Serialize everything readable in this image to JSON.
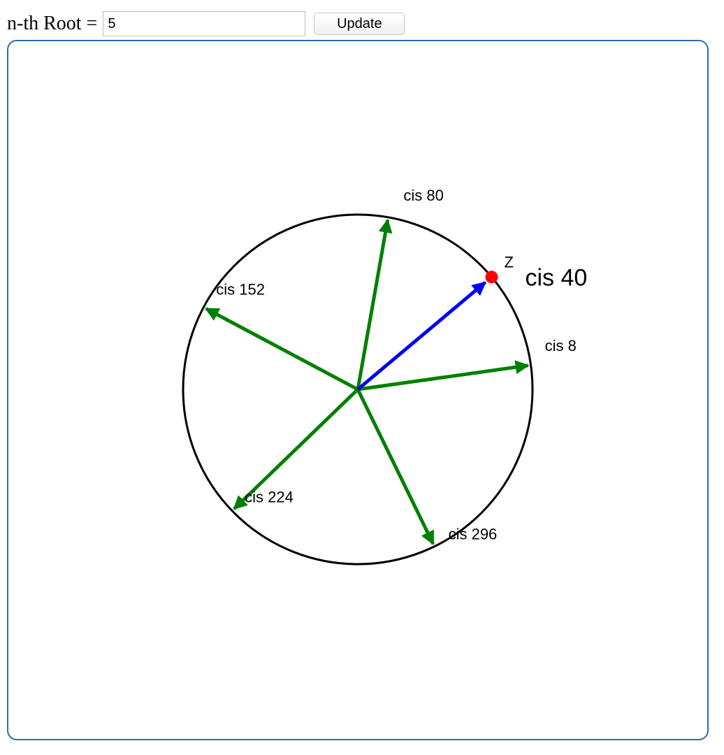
{
  "toolbar": {
    "root_label": "n-th Root =",
    "root_value": "5",
    "update_label": "Update"
  },
  "diagram": {
    "z": {
      "label": "Z",
      "value_label": "cis 40",
      "angle_deg": 40,
      "color": "#0000ee",
      "point_color": "#ff0000"
    },
    "roots": [
      {
        "label": "cis 8",
        "angle_deg": 8
      },
      {
        "label": "cis 80",
        "angle_deg": 80
      },
      {
        "label": "cis 152",
        "angle_deg": 152
      },
      {
        "label": "cis 224",
        "angle_deg": 224
      },
      {
        "label": "cis 296",
        "angle_deg": 296
      }
    ],
    "root_color": "#008000",
    "circle_color": "#000000"
  }
}
